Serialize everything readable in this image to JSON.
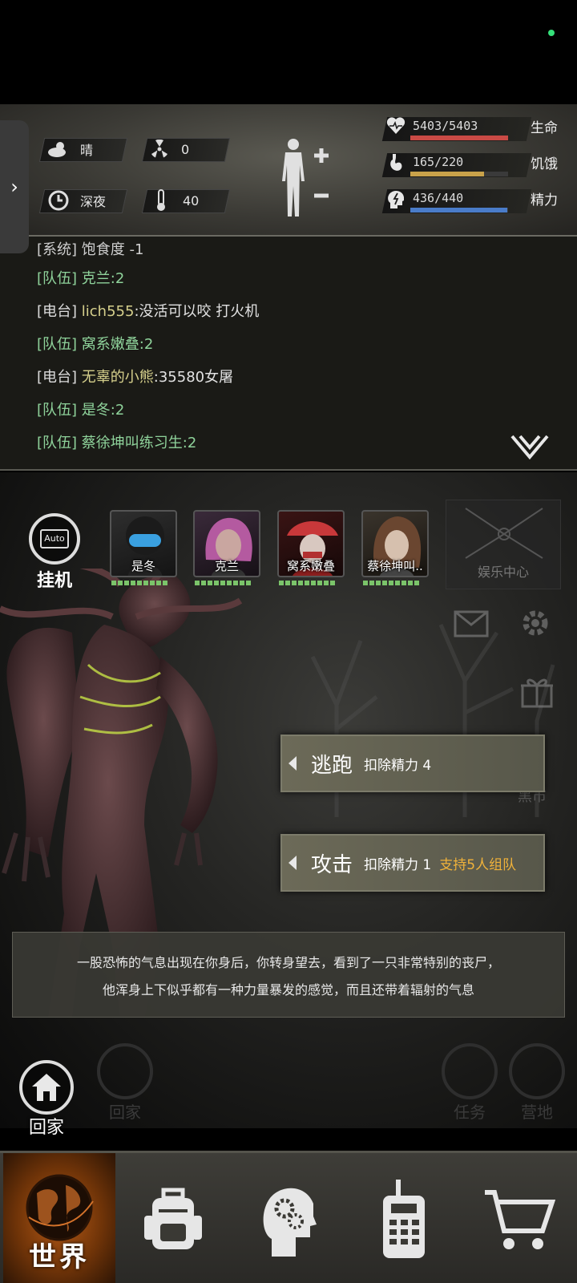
{
  "stats": {
    "weather": "晴",
    "radiation": "0",
    "time_of_day": "深夜",
    "temperature": "40",
    "vitals": [
      {
        "icon": "heart-icon",
        "value": "5403/5403",
        "label": "生命",
        "fraction": 1.0,
        "color": "#c94a45"
      },
      {
        "icon": "stomach-icon",
        "value": "165/220",
        "label": "饥饿",
        "fraction": 0.75,
        "color": "#c9a24a"
      },
      {
        "icon": "brain-icon",
        "value": "436/440",
        "label": "精力",
        "fraction": 0.99,
        "color": "#4a7cc9"
      }
    ]
  },
  "chat": {
    "partial_line": "[系统] 饱食度 -1",
    "lines": [
      {
        "channel": "[队伍]",
        "name": "克兰",
        "msg": ":2",
        "type": "team"
      },
      {
        "channel": "[电台]",
        "name": "lich555",
        "msg": ":没活可以咬 打火机",
        "type": "radio"
      },
      {
        "channel": "[队伍]",
        "name": "窝系嫩叠",
        "msg": ":2",
        "type": "team"
      },
      {
        "channel": "[电台]",
        "name": "无辜的小熊",
        "msg": ":35580女屠",
        "type": "radio"
      },
      {
        "channel": "[队伍]",
        "name": "是冬",
        "msg": ":2",
        "type": "team"
      },
      {
        "channel": "[队伍]",
        "name": "蔡徐坤叫练习生",
        "msg": ":2",
        "type": "team"
      }
    ]
  },
  "auto": {
    "screen": "Auto",
    "label": "挂机"
  },
  "team": [
    {
      "name": "是冬"
    },
    {
      "name": "克兰"
    },
    {
      "name": "窝系嫩叠"
    },
    {
      "name": "蔡徐坤叫.."
    }
  ],
  "entertainment": "娱乐中心",
  "actions": {
    "flee": {
      "title": "逃跑",
      "cost": "扣除精力 4"
    },
    "attack": {
      "title": "攻击",
      "cost": "扣除精力 1",
      "team_note": "支持5人组队"
    }
  },
  "narration": {
    "line1": "一股恐怖的气息出现在你身后，你转身望去，看到了一只非常特别的丧尸，",
    "line2": "他浑身上下似乎都有一种力量暴发的感觉，而且还带着辐射的气息"
  },
  "home": {
    "label": "回家"
  },
  "background_labels": {
    "market": "黑市",
    "home2": "回家",
    "task": "任务",
    "camp": "营地"
  },
  "nav": {
    "world": "世界"
  }
}
